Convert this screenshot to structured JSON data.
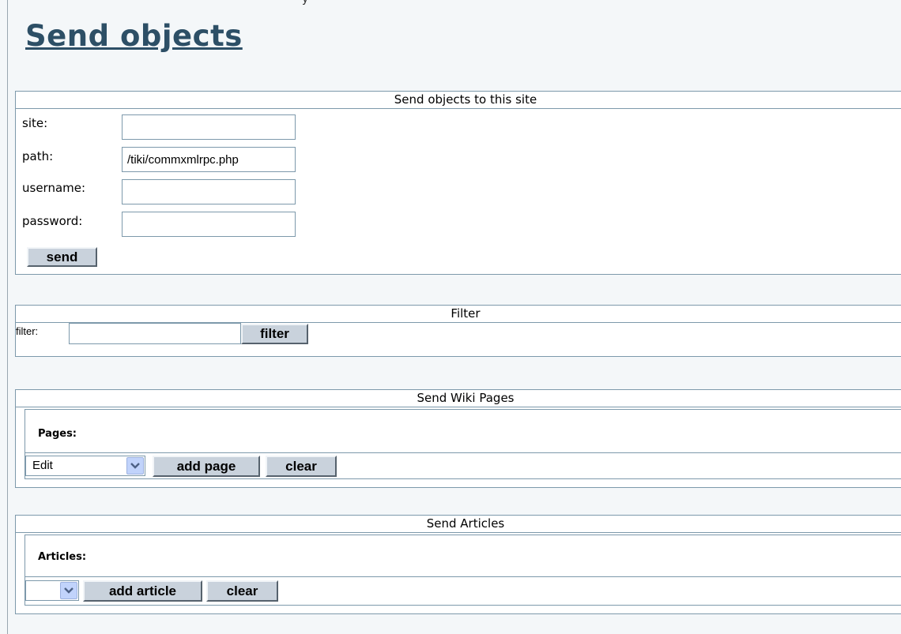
{
  "page": {
    "title": "Send objects",
    "top_fragment": "y"
  },
  "send_section": {
    "header": "Send objects to this site",
    "site_label": "site:",
    "site_value": "",
    "path_label": "path:",
    "path_value": "/tiki/commxmlrpc.php",
    "username_label": "username:",
    "username_value": "",
    "password_label": "password:",
    "password_value": "",
    "send_button": "send"
  },
  "filter_section": {
    "header": "Filter",
    "filter_label": "filter:",
    "filter_value": "",
    "filter_button": "filter"
  },
  "wiki_section": {
    "header": "Send Wiki Pages",
    "pages_label": "Pages:",
    "select_value": "Edit",
    "add_button": "add page",
    "clear_button": "clear"
  },
  "articles_section": {
    "header": "Send Articles",
    "articles_label": "Articles:",
    "select_value": "",
    "add_button": "add article",
    "clear_button": "clear"
  },
  "icons": {
    "dropdown": "chevron-down-icon"
  },
  "colors": {
    "title": "#2d4f66",
    "border": "#7d99ab",
    "button": "#c9d2dc",
    "background": "#f4f7f9"
  }
}
